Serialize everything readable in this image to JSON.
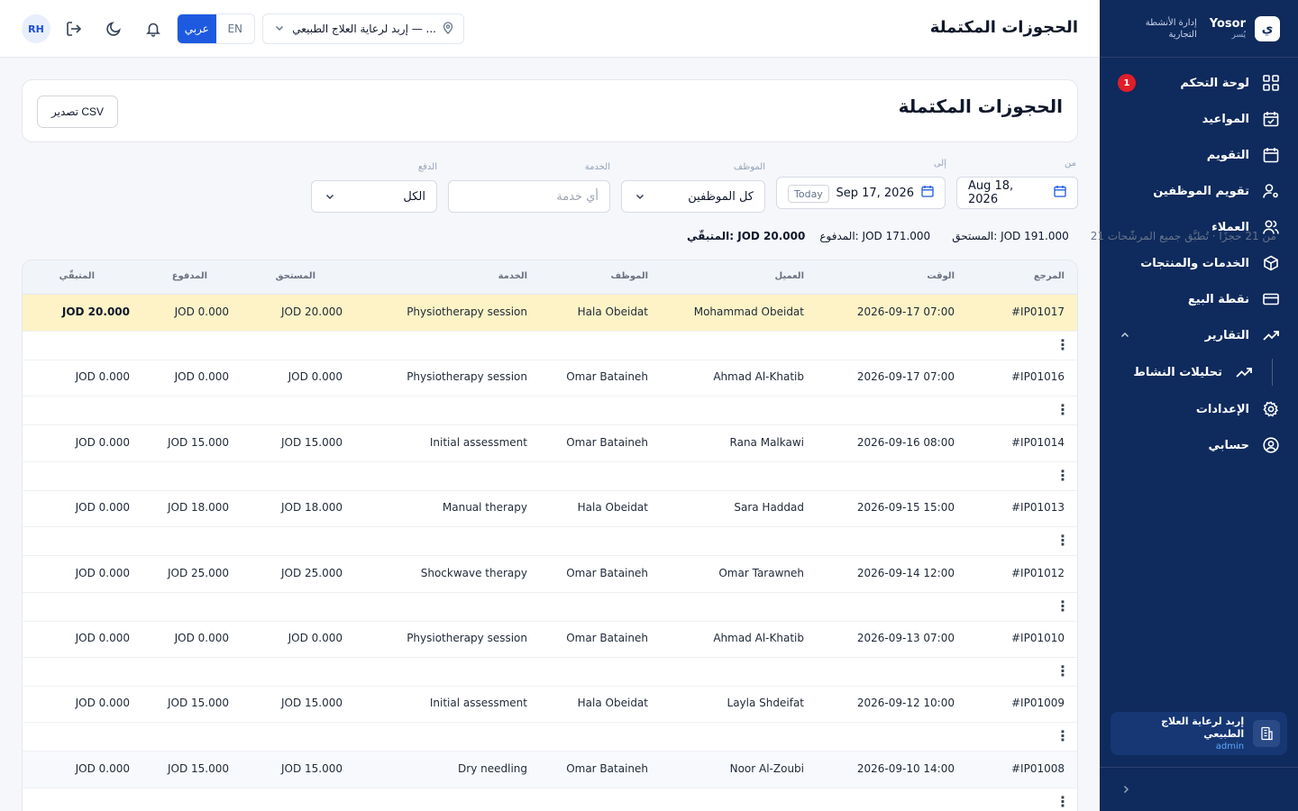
{
  "brand": {
    "name": "Yosor",
    "sub": "يُسر",
    "logo": "ي",
    "desc_line1": "إدارة الأنشطة",
    "desc_line2": "التجارية"
  },
  "nav": [
    {
      "label": "لوحة التحكم",
      "icon": "dashboard-grid-icon",
      "badge": "1"
    },
    {
      "label": "المواعيد",
      "icon": "calendar-check-icon"
    },
    {
      "label": "التقويم",
      "icon": "calendar-icon"
    },
    {
      "label": "تقويم الموظفين",
      "icon": "user-cog-icon"
    },
    {
      "label": "العملاء",
      "icon": "users-icon"
    },
    {
      "label": "الخدمات والمنتجات",
      "icon": "box-icon"
    },
    {
      "label": "نقطة البيع",
      "icon": "credit-card-icon"
    },
    {
      "label": "التقارير",
      "icon": "trending-up-icon"
    }
  ],
  "nav_sub": {
    "label": "تحليلات النشاط",
    "icon": "trending-up-icon"
  },
  "nav_after": [
    {
      "label": "الإعدادات",
      "icon": "gear-icon"
    },
    {
      "label": "حسابي",
      "icon": "user-circle-icon"
    }
  ],
  "tenant": {
    "name": "إربد لرعاية العلاج الطبيعي",
    "role": "admin"
  },
  "topbar": {
    "title": "الحجوزات المكتملة",
    "avatar": "RH",
    "lang_ar": "عربي",
    "lang_en": "EN",
    "location": "إربد لرعاية العلاج الطبيعي — ..."
  },
  "header": {
    "title": "الحجوزات المكتملة",
    "export_label": "تصدير CSV"
  },
  "filters": {
    "from_label": "من",
    "from_value": "Aug 18, 2026",
    "to_label": "إلى",
    "to_value": "Sep 17, 2026",
    "today": "Today",
    "staff_label": "الموظف",
    "staff_value": "كل الموظفين",
    "service_label": "الخدمة",
    "service_placeholder": "أي خدمة",
    "payment_label": "الدفع",
    "payment_value": "الكل"
  },
  "summary": {
    "count": "21 من 21 حجزًا · تُطبَّق جميع المرشّحات",
    "due": "المستحق: JOD 191.000",
    "paid": "المدفوع: JOD 171.000",
    "remaining": "المتبقّي: JOD 20.000"
  },
  "table": {
    "headers": {
      "ref": "المرجع",
      "time": "الوقت",
      "customer": "العميل",
      "staff": "الموظف",
      "service": "الخدمة",
      "due": "المستحق",
      "paid": "المدفوع",
      "remaining": "المتبقّي"
    },
    "rows": [
      {
        "ref": "#IP01017",
        "time": "2026-09-17 07:00",
        "customer": "Mohammad Obeidat",
        "staff": "Hala Obeidat",
        "service": "Physiotherapy session",
        "due": "JOD 20.000",
        "paid": "JOD 0.000",
        "remaining": "JOD 20.000"
      },
      {
        "ref": "#IP01016",
        "time": "2026-09-17 07:00",
        "customer": "Ahmad Al-Khatib",
        "staff": "Omar Bataineh",
        "service": "Physiotherapy session",
        "due": "JOD 0.000",
        "paid": "JOD 0.000",
        "remaining": "JOD 0.000"
      },
      {
        "ref": "#IP01014",
        "time": "2026-09-16 08:00",
        "customer": "Rana Malkawi",
        "staff": "Omar Bataineh",
        "service": "Initial assessment",
        "due": "JOD 15.000",
        "paid": "JOD 15.000",
        "remaining": "JOD 0.000"
      },
      {
        "ref": "#IP01013",
        "time": "2026-09-15 15:00",
        "customer": "Sara Haddad",
        "staff": "Hala Obeidat",
        "service": "Manual therapy",
        "due": "JOD 18.000",
        "paid": "JOD 18.000",
        "remaining": "JOD 0.000"
      },
      {
        "ref": "#IP01012",
        "time": "2026-09-14 12:00",
        "customer": "Omar Tarawneh",
        "staff": "Omar Bataineh",
        "service": "Shockwave therapy",
        "due": "JOD 25.000",
        "paid": "JOD 25.000",
        "remaining": "JOD 0.000"
      },
      {
        "ref": "#IP01010",
        "time": "2026-09-13 07:00",
        "customer": "Ahmad Al-Khatib",
        "staff": "Omar Bataineh",
        "service": "Physiotherapy session",
        "due": "JOD 0.000",
        "paid": "JOD 0.000",
        "remaining": "JOD 0.000"
      },
      {
        "ref": "#IP01009",
        "time": "2026-09-12 10:00",
        "customer": "Layla Shdeifat",
        "staff": "Hala Obeidat",
        "service": "Initial assessment",
        "due": "JOD 15.000",
        "paid": "JOD 15.000",
        "remaining": "JOD 0.000"
      },
      {
        "ref": "#IP01008",
        "time": "2026-09-10 14:00",
        "customer": "Noor Al-Zoubi",
        "staff": "Omar Bataineh",
        "service": "Dry needling",
        "due": "JOD 15.000",
        "paid": "JOD 15.000",
        "remaining": "JOD 0.000"
      }
    ]
  },
  "colors": {
    "sidebar": "#0f2a5c",
    "accent": "#1d5ae0",
    "highlight_row": "#fdf3c7",
    "badge": "#e11d2a"
  }
}
